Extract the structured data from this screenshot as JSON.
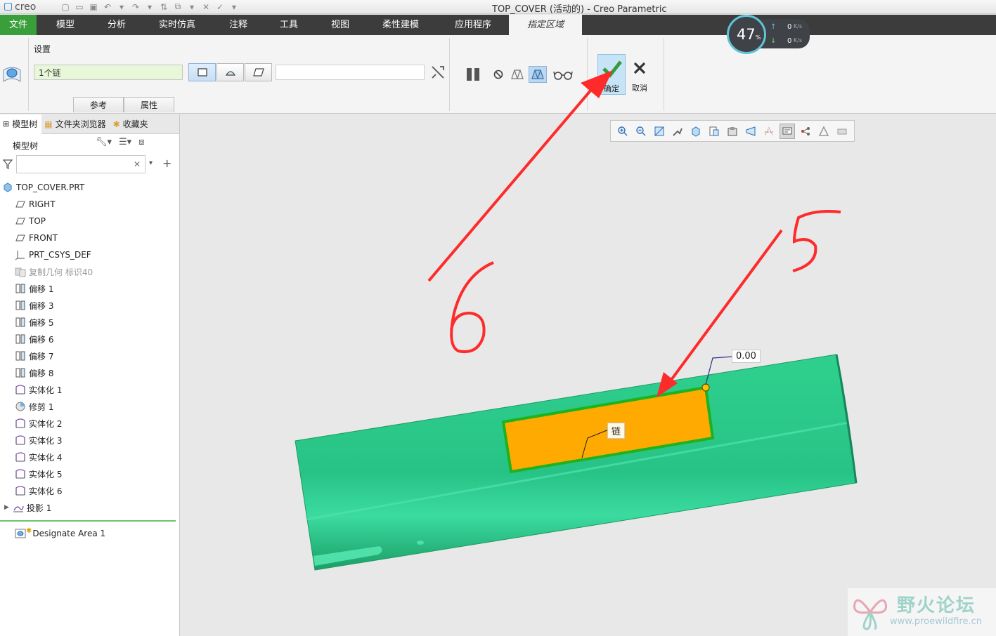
{
  "window": {
    "app_logo": "creo",
    "title": "TOP_COVER (活动的) - Creo Parametric"
  },
  "ribbon_tabs": [
    "文件",
    "模型",
    "分析",
    "实时仿真",
    "注释",
    "工具",
    "视图",
    "柔性建模",
    "应用程序",
    "指定区域"
  ],
  "ribbon": {
    "group_label": "设置",
    "chain_field_value": "1个链",
    "subtabs": [
      "参考",
      "属性"
    ],
    "ok_label": "确定",
    "cancel_label": "取消"
  },
  "network_widget": {
    "percent": "47",
    "percent_unit": "%",
    "upload": "0",
    "download": "0",
    "unit": "K/s"
  },
  "panel_tabs": [
    "模型树",
    "文件夹浏览器",
    "收藏夹"
  ],
  "model_tree": {
    "header": "模型树",
    "search_placeholder": "",
    "items": [
      {
        "label": "TOP_COVER.PRT",
        "icon": "part-icon"
      },
      {
        "label": "RIGHT",
        "icon": "datum-plane-icon"
      },
      {
        "label": "TOP",
        "icon": "datum-plane-icon"
      },
      {
        "label": "FRONT",
        "icon": "datum-plane-icon"
      },
      {
        "label": "PRT_CSYS_DEF",
        "icon": "csys-icon"
      },
      {
        "label": "复制几何 标识40",
        "icon": "copy-geometry-icon"
      },
      {
        "label": "偏移 1",
        "icon": "offset-icon"
      },
      {
        "label": "偏移 3",
        "icon": "offset-icon"
      },
      {
        "label": "偏移 5",
        "icon": "offset-icon"
      },
      {
        "label": "偏移 6",
        "icon": "offset-icon"
      },
      {
        "label": "偏移 7",
        "icon": "offset-icon"
      },
      {
        "label": "偏移 8",
        "icon": "offset-icon"
      },
      {
        "label": "实体化 1",
        "icon": "solidify-icon"
      },
      {
        "label": "修剪 1",
        "icon": "trim-icon"
      },
      {
        "label": "实体化 2",
        "icon": "solidify-icon"
      },
      {
        "label": "实体化 3",
        "icon": "solidify-icon"
      },
      {
        "label": "实体化 4",
        "icon": "solidify-icon"
      },
      {
        "label": "实体化 5",
        "icon": "solidify-icon"
      },
      {
        "label": "实体化 6",
        "icon": "solidify-icon"
      },
      {
        "label": "投影 1",
        "icon": "project-icon"
      }
    ],
    "insert_item": "Designate Area 1"
  },
  "graphics": {
    "dimension_label": "0.00",
    "chain_label": "链",
    "handwritten_numbers": [
      "6",
      "5"
    ]
  },
  "watermark": {
    "title": "野火论坛",
    "url": "www.proewildfire.cn"
  },
  "colors": {
    "file_tab": "#3a9e3a",
    "part_body": "#2ec98a",
    "selected_region": "#ffaa00",
    "chain_outline": "#1fb21f",
    "annotation": "#ff2a2a"
  }
}
